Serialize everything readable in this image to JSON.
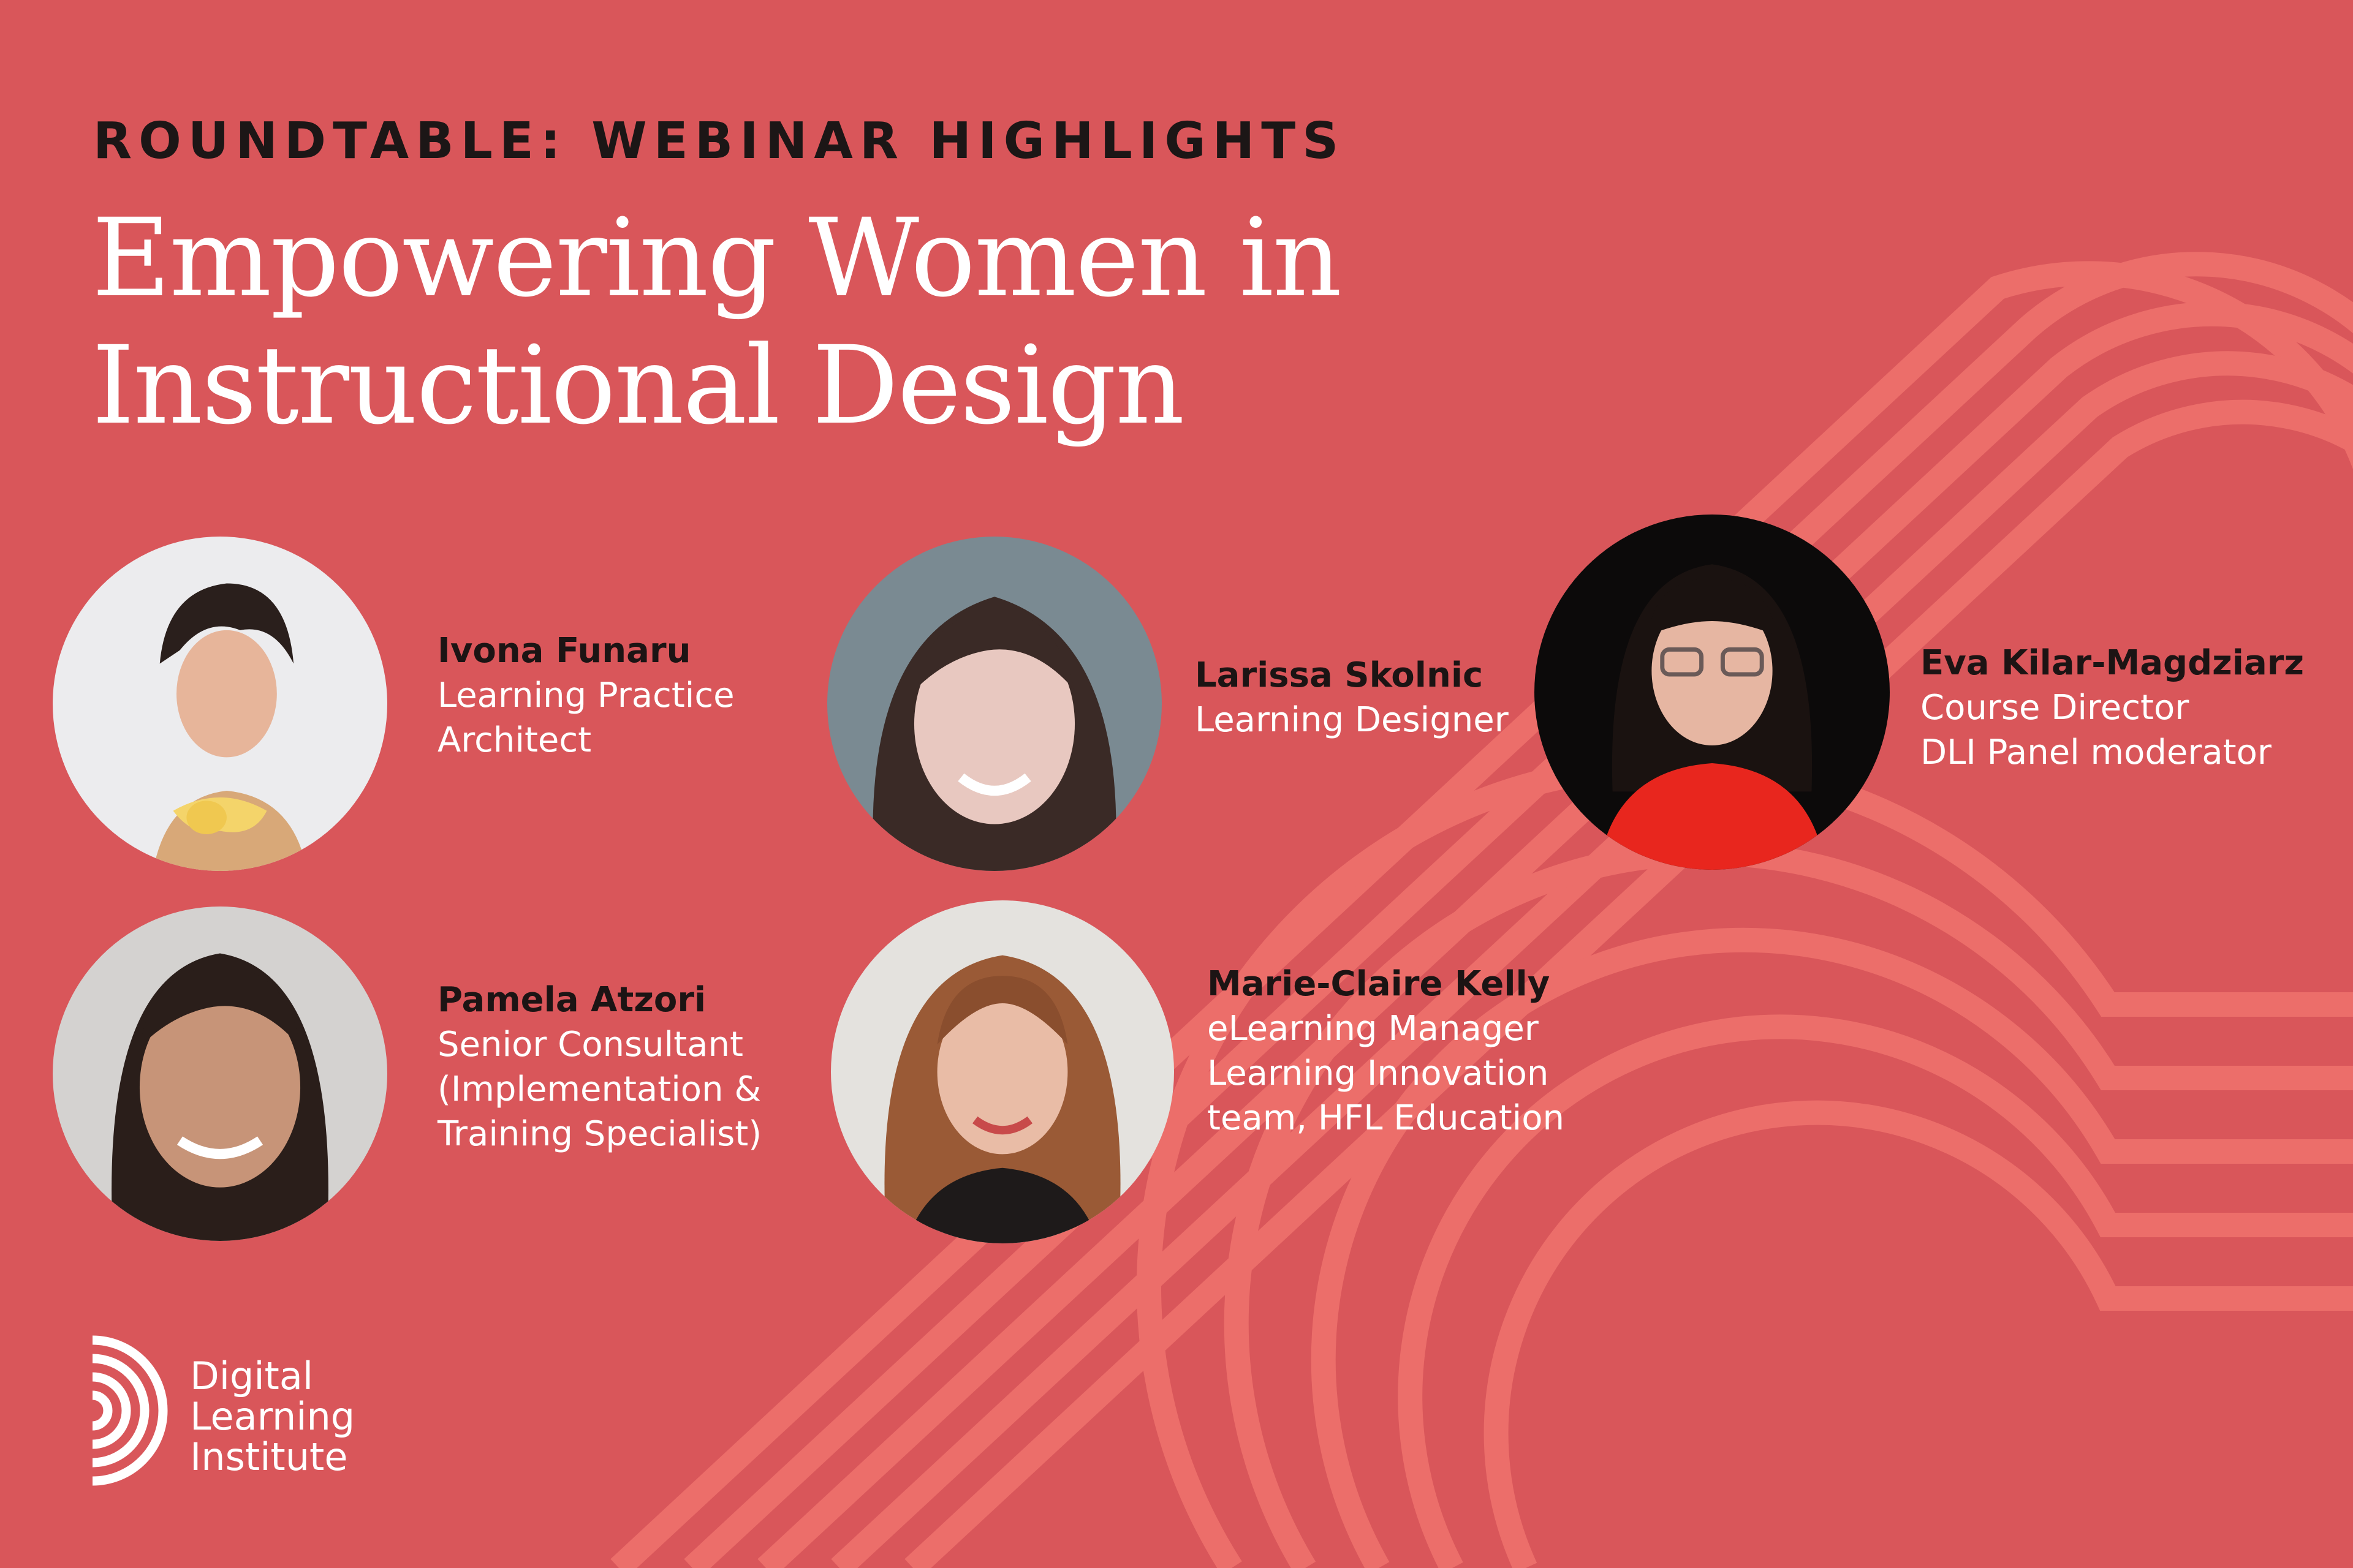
{
  "header": {
    "eyebrow": "ROUNDTABLE: WEBINAR HIGHLIGHTS",
    "title_line1": "Empowering Women in",
    "title_line2": "Instructional Design"
  },
  "colors": {
    "background": "#d9565a",
    "pattern": "#ec6e6a",
    "name_text": "#1c1414",
    "role_text": "#ffffff"
  },
  "speakers": [
    {
      "name": "Ivona Funaru",
      "role_lines": [
        "Learning Practice",
        "Architect"
      ]
    },
    {
      "name": "Larissa Skolnic",
      "role_lines": [
        "Learning Designer"
      ]
    },
    {
      "name": "Eva Kilar-Magdziarz",
      "role_lines": [
        "Course Director",
        "DLI Panel moderator"
      ]
    },
    {
      "name": "Pamela Atzori",
      "role_lines": [
        "Senior Consultant",
        "(Implementation &",
        "Training Specialist)"
      ]
    },
    {
      "name": "Marie-Claire Kelly",
      "role_lines": [
        "eLearning Manager",
        "Learning Innovation",
        "team, HFL Education"
      ]
    }
  ],
  "logo": {
    "line1": "Digital",
    "line2": "Learning",
    "line3": "Institute",
    "icon": "concentric-arcs-logo-icon"
  }
}
